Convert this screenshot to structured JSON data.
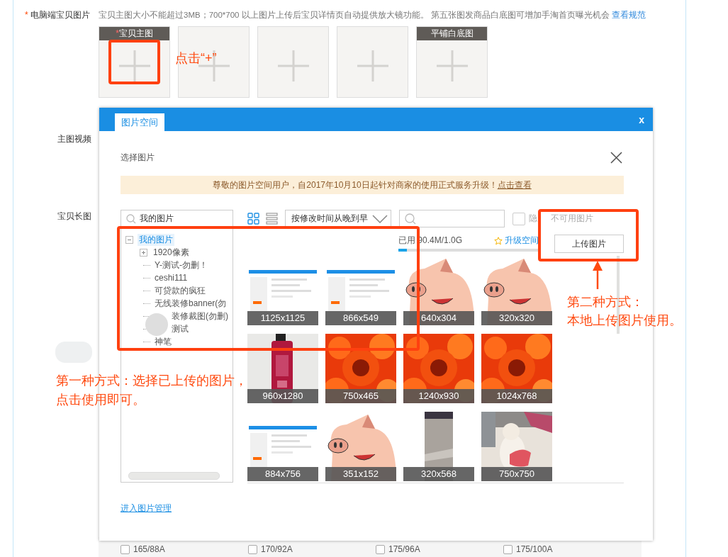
{
  "form": {
    "label_mark": "*",
    "label": "电脑端宝贝图片",
    "hint": "宝贝主图大小不能超过3MB；700*700 以上图片上传后宝贝详情页自动提供放大镜功能。 第五张图发商品白底图可增加手淘首页曝光机会",
    "hint_link": "查看规范",
    "slots": [
      {
        "kind": "labeled",
        "header_mark": "*",
        "header": "宝贝主图"
      },
      {
        "kind": "empty"
      },
      {
        "kind": "empty"
      },
      {
        "kind": "empty"
      },
      {
        "kind": "labeled",
        "header": "平铺白底图"
      }
    ],
    "labels": [
      "主图视频",
      "宝贝长图"
    ],
    "sizes": [
      {
        "label": "165/88A",
        "checked": false
      },
      {
        "label": "170/92A",
        "checked": false
      },
      {
        "label": "175/96A",
        "checked": false
      },
      {
        "label": "175/100A",
        "checked": false
      }
    ]
  },
  "dialog": {
    "tab": "图片空间",
    "close": "x",
    "heading": "选择图片",
    "notice": "尊敬的图片空间用户，自2017年10月10日起针对商家的使用正式服务升级！",
    "notice_link": "点击查看",
    "folder_search": {
      "value": "我的图片"
    },
    "views": [
      {
        "kind": "grid",
        "selected": true
      },
      {
        "kind": "list",
        "selected": false
      }
    ],
    "sort": "按修改时间从晚到早",
    "hide_unavailable": {
      "label_parts": [
        "隐",
        "不可用图片"
      ],
      "checked": false
    },
    "usage": {
      "text": "已用 90.4M/1.0G",
      "level": 0.06
    },
    "upgrade": "升级空间",
    "upload": "上传图片",
    "tree": {
      "label": "我的图片",
      "expanded": true,
      "selected": true,
      "children": [
        {
          "label": "1920像素",
          "kind": "folder",
          "expanded": false
        },
        {
          "label": "Y-测试-勿删！",
          "kind": "leaf"
        },
        {
          "label": "ceshi111",
          "kind": "leaf"
        },
        {
          "label": "可贷款的疯狂",
          "kind": "leaf"
        },
        {
          "label": "无线装修banner(勿",
          "kind": "leaf"
        },
        {
          "label": "装修裁图(勿删)",
          "kind": "leaf"
        },
        {
          "label": "测试",
          "kind": "leaf"
        },
        {
          "label": "神笔",
          "kind": "leaf"
        }
      ]
    },
    "images": [
      {
        "caption": "1125x1125",
        "kind": "picture"
      },
      {
        "caption": "866x549",
        "kind": "picture"
      },
      {
        "caption": "640x304",
        "kind": "picture"
      },
      {
        "caption": "320x320",
        "kind": "picture"
      },
      {
        "caption": "960x1280",
        "kind": "picture"
      },
      {
        "caption": "750x465",
        "kind": "picture"
      },
      {
        "caption": "1240x930",
        "kind": "picture"
      },
      {
        "caption": "1024x768",
        "kind": "picture"
      },
      {
        "caption": "884x756",
        "kind": "picture"
      },
      {
        "caption": "351x152",
        "kind": "picture"
      },
      {
        "caption": "320x568",
        "kind": "picture"
      },
      {
        "caption": "750x750",
        "kind": "picture"
      }
    ],
    "manage_link": "进入图片管理"
  },
  "annotations": {
    "click_hint": "点击“+”",
    "method_two": [
      "第二种方式：",
      "本地上传图片使用。"
    ],
    "method_one": [
      "第一种方式：选择已上传的图片，",
      "点击使用即可。"
    ]
  }
}
